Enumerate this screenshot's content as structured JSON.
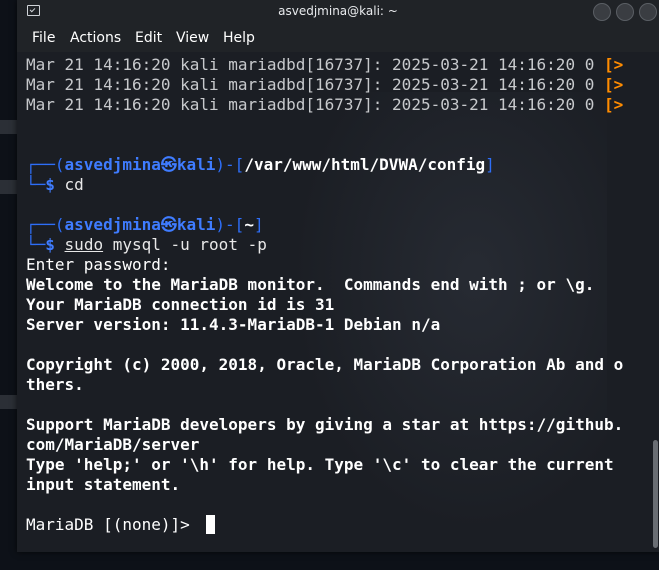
{
  "window": {
    "title": "asvedjmina@kali: ~"
  },
  "menu": [
    "File",
    "Actions",
    "Edit",
    "View",
    "Help"
  ],
  "terminal": {
    "log_lines": [
      "Mar 21 14:16:20 kali mariadbd[16737]: 2025-03-21 14:16:20 0 ",
      "Mar 21 14:16:20 kali mariadbd[16737]: 2025-03-21 14:16:20 0 ",
      "Mar 21 14:16:20 kali mariadbd[16737]: 2025-03-21 14:16:20 0 "
    ],
    "log_overflow": "[>",
    "prompt1": {
      "open": "┌──(",
      "user": "asvedjmina",
      "sep": "㉿",
      "host": "kali",
      "mid": ")-[",
      "path": "/var/www/html/DVWA/config",
      "close": "]",
      "prefix": "└─",
      "dollar": "$",
      "command": " cd"
    },
    "prompt2": {
      "open": "┌──(",
      "user": "asvedjmina",
      "sep": "㉿",
      "host": "kali",
      "mid": ")-[",
      "path": "~",
      "close": "]",
      "prefix": "└─",
      "dollar": "$",
      "cmd_sudo": "sudo",
      "cmd_rest_a": " mysql ",
      "cmd_flag_u": "-u",
      "cmd_rest_b": " root ",
      "cmd_flag_p": "-p"
    },
    "output": [
      "Enter password:",
      "Welcome to the MariaDB monitor.  Commands end with ; or \\g.",
      "Your MariaDB connection id is 31",
      "Server version: 11.4.3-MariaDB-1 Debian n/a",
      "",
      "Copyright (c) 2000, 2018, Oracle, MariaDB Corporation Ab and o",
      "thers.",
      "",
      "Support MariaDB developers by giving a star at https://github.",
      "com/MariaDB/server",
      "Type 'help;' or '\\h' for help. Type '\\c' to clear the current",
      "input statement.",
      "",
      "MariaDB [(none)]> "
    ]
  }
}
